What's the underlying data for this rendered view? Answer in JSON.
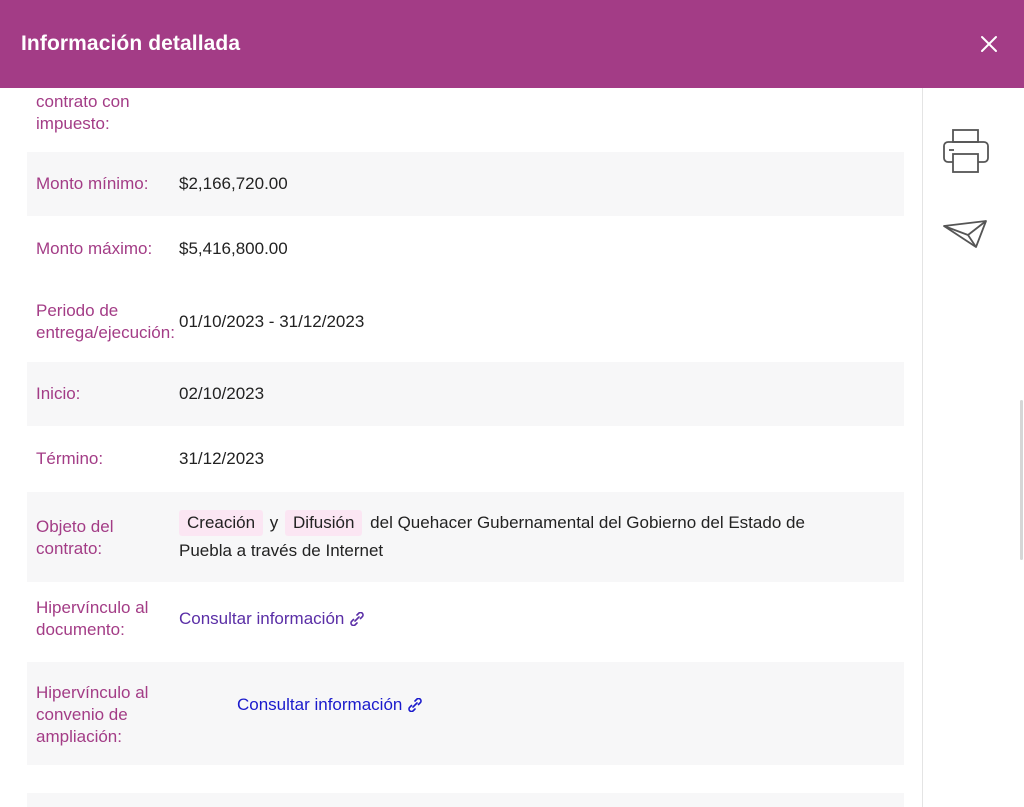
{
  "header": {
    "title": "Información detallada",
    "close_icon": "close-icon"
  },
  "side_rail": {
    "print_icon": "printer-icon",
    "send_icon": "paper-plane-icon"
  },
  "rows": {
    "contract_tax": {
      "label": "contrato con impuesto:"
    },
    "min_amount": {
      "label": "Monto mínimo:",
      "value": "$2,166,720.00"
    },
    "max_amount": {
      "label": "Monto máximo:",
      "value": "$5,416,800.00"
    },
    "period": {
      "label": "Periodo de entrega/ejecución:",
      "value": "01/10/2023 - 31/12/2023"
    },
    "start": {
      "label": "Inicio:",
      "value": "02/10/2023"
    },
    "end": {
      "label": "Término:",
      "value": "31/12/2023"
    },
    "object": {
      "label": "Objeto del contrato:",
      "chip1": "Creación",
      "conj": "y",
      "chip2": "Difusión",
      "rest_line1": "del Quehacer Gubernamental del Gobierno del Estado de",
      "rest_line2": "Puebla a través de Internet"
    },
    "doc_link": {
      "label": "Hipervínculo al documento:",
      "link_text": "Consultar información"
    },
    "extension_link": {
      "label": "Hipervínculo al convenio de ampliación:",
      "link_text": "Consultar información"
    }
  },
  "colors": {
    "accent": "#a33c86",
    "link_purple": "#5a2ea6",
    "link_blue": "#1a1acc",
    "chip_bg": "#fbe6f3"
  }
}
